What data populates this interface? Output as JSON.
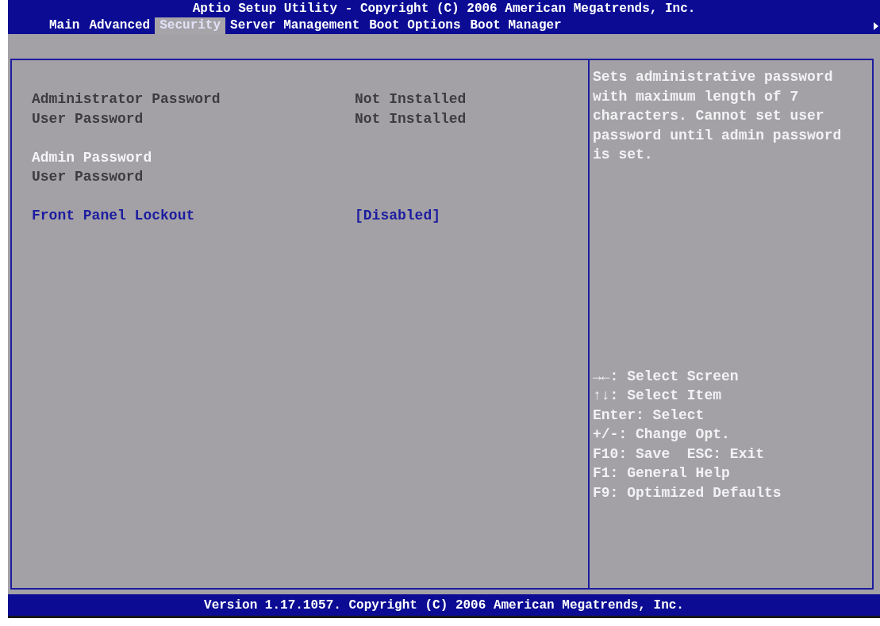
{
  "window": {
    "title": "Aptio Setup Utility - Copyright (C) 2006 American Megatrends, Inc."
  },
  "tabs": [
    {
      "label": "Main",
      "selected": false
    },
    {
      "label": "Advanced",
      "selected": false
    },
    {
      "label": "Security",
      "selected": true
    },
    {
      "label": "Server Management",
      "selected": false
    },
    {
      "label": "Boot Options",
      "selected": false
    },
    {
      "label": "Boot Manager",
      "selected": false
    }
  ],
  "settings": [
    {
      "items": [
        {
          "label": "Administrator Password",
          "value": "Not Installed",
          "selected": false,
          "disabled": true
        },
        {
          "label": "User Password",
          "value": "Not Installed",
          "selected": false,
          "disabled": true
        }
      ]
    },
    {
      "items": [
        {
          "label": "Admin Password",
          "selected": true,
          "disabled": false
        },
        {
          "label": "User Password",
          "selected": false,
          "disabled": true
        }
      ]
    },
    {
      "items": [
        {
          "label": "Front Panel Lockout",
          "value": "[Disabled]",
          "selected": false,
          "disabled": false
        }
      ]
    }
  ],
  "help": {
    "description": "Sets administrative password with maximum length of 7 characters. Cannot set user password until admin password is set.",
    "keys": [
      "→←: Select Screen",
      "↑↓: Select Item",
      "Enter: Select",
      "+/-: Change Opt.",
      "F10: Save  ESC: Exit",
      "F1: General Help",
      "F9: Optimized Defaults"
    ]
  },
  "status_bar": {
    "text": "Version 1.17.1057. Copyright (C) 2006 American Megatrends, Inc."
  }
}
